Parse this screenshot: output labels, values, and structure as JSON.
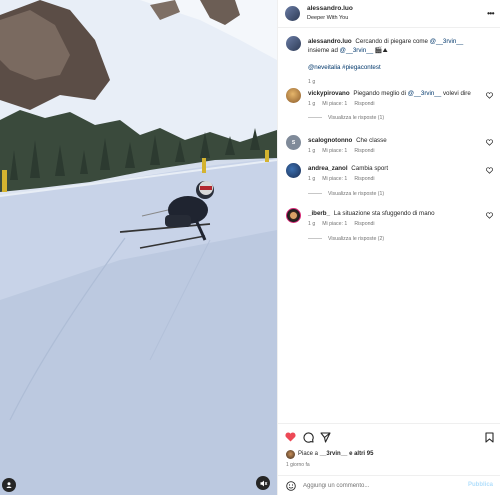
{
  "post": {
    "author": "alessandro.luo",
    "audio_subtitle": "Deeper With You"
  },
  "caption": {
    "user": "alessandro.luo",
    "text_before": "Cercando di piegare come",
    "mention1": "@__3rvin__",
    "text_middle": "insieme ad",
    "mention2": "@__3rvin__",
    "emojis": "🎬⛰",
    "hashtags": "@neveitalia #piegacontest",
    "time": "1 g"
  },
  "comments": [
    {
      "user": "vickypirovano",
      "text_before": "Piegando meglio di",
      "mention": "@__3rvin__",
      "text_after": "volevi dire",
      "time": "1 g",
      "likes": "Mi piace: 1",
      "reply_label": "Rispondi",
      "view_replies": "Visualizza le risposte (1)"
    },
    {
      "user": "scalognotonno",
      "text": "Che classe",
      "time": "1 g",
      "likes": "Mi piace: 1",
      "reply_label": "Rispondi",
      "avatar_letter": "S"
    },
    {
      "user": "andrea_zanol",
      "text": "Cambia sport",
      "time": "1 g",
      "likes": "Mi piace: 1",
      "reply_label": "Rispondi",
      "view_replies": "Visualizza le risposte (1)"
    },
    {
      "user": "_iberb_",
      "text": "La situazione sta sfuggendo di mano",
      "time": "1 g",
      "likes": "Mi piace: 1",
      "reply_label": "Rispondi",
      "view_replies": "Visualizza le risposte (2)"
    }
  ],
  "likes_summary": {
    "prefix": "Piace a",
    "user": "__3rvin__",
    "suffix": "e altri 95"
  },
  "time_ago": "1 giorno fa",
  "add_comment": {
    "placeholder": "Aggiungi un commento...",
    "publish_label": "Pubblica"
  },
  "colors": {
    "like_red": "#ed4956",
    "link_blue": "#00376b",
    "publish_disabled": "#b2dffc"
  }
}
